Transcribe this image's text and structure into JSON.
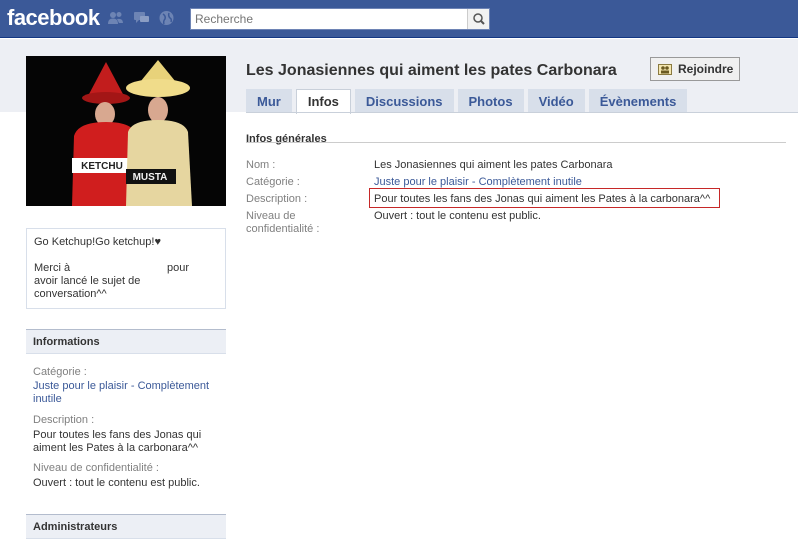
{
  "topbar": {
    "logo": "facebook",
    "search_placeholder": "Recherche"
  },
  "page": {
    "title": "Les Jonasiennes qui aiment les pates Carbonara",
    "join_label": "Rejoindre"
  },
  "tabs": [
    {
      "label": "Mur"
    },
    {
      "label": "Infos"
    },
    {
      "label": "Discussions"
    },
    {
      "label": "Photos"
    },
    {
      "label": "Vidéo"
    },
    {
      "label": "Évènements"
    }
  ],
  "photo": {
    "costume_left": "KETCHU",
    "costume_right": "MUSTA"
  },
  "main": {
    "heading": "Infos générales",
    "name_label": "Nom :",
    "name_value": "Les Jonasiennes qui aiment les pates Carbonara",
    "category_label": "Catégorie :",
    "category_link1": "Juste pour le plaisir",
    "category_sep": " - ",
    "category_link2": "Complètement inutile",
    "description_label": "Description :",
    "description_value": "Pour toutes les fans des Jonas qui aiment les Pates à la carbonara^^",
    "privacy_label_line1": "Niveau de",
    "privacy_label_line2": "confidentialité :",
    "privacy_value": "Ouvert : tout le contenu est public."
  },
  "sidebar": {
    "about_line1": "Go Ketchup!Go ketchup!♥",
    "about_merci": "Merci à",
    "about_pour": "pour",
    "about_line3": "avoir lancé le sujet de",
    "about_line4": "conversation^^",
    "info_header": "Informations",
    "category_label": "Catégorie :",
    "category_link1": "Juste pour le plaisir",
    "category_sep": " - ",
    "category_link2_a": "Complètement",
    "category_link2_b": "inutile",
    "description_label": "Description :",
    "description_line1": "Pour toutes les fans des Jonas qui",
    "description_line2": "aiment les Pates à la carbonara^^",
    "privacy_label": "Niveau de confidentialité :",
    "privacy_value": "Ouvert : tout le contenu est public.",
    "admin_header": "Administrateurs"
  },
  "colors": {
    "brand_blue": "#3b5998",
    "tab_bg": "#d8dfea",
    "highlight_red": "#c62828"
  }
}
